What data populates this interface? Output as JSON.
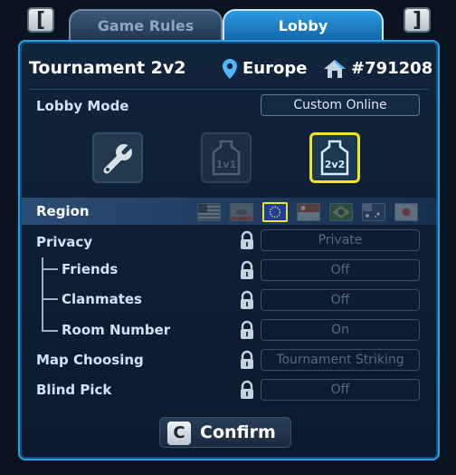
{
  "top_nav": {
    "prev_key": "[",
    "next_key": "]"
  },
  "tabs": [
    {
      "label": "Game Rules"
    },
    {
      "label": "Lobby"
    }
  ],
  "header": {
    "title": "Tournament 2v2",
    "region": "Europe",
    "lobby_id": "#791208"
  },
  "lobby_mode": {
    "label": "Lobby Mode",
    "value": "Custom Online",
    "modes": [
      {
        "icon": "wrench-icon"
      },
      {
        "icon": "1v1-mode-icon",
        "text": "1v1"
      },
      {
        "icon": "2v2-mode-icon",
        "text": "2v2",
        "selected": true
      }
    ]
  },
  "region_row": {
    "label": "Region",
    "flags": [
      "usa-flag-icon",
      "california-flag-icon",
      "eu-flag-icon",
      "singapore-flag-icon",
      "brazil-flag-icon",
      "australia-flag-icon",
      "japan-flag-icon"
    ],
    "selected_index": 2
  },
  "settings": {
    "privacy": {
      "label": "Privacy",
      "value": "Private"
    },
    "friends": {
      "label": "Friends",
      "value": "Off"
    },
    "clanmates": {
      "label": "Clanmates",
      "value": "Off"
    },
    "room_number": {
      "label": "Room Number",
      "value": "On"
    },
    "map_choosing": {
      "label": "Map Choosing",
      "value": "Tournament Striking"
    },
    "blind_pick": {
      "label": "Blind Pick",
      "value": "Off"
    }
  },
  "confirm": {
    "key": "C",
    "label": "Confirm"
  },
  "colors": {
    "accent": "#2e9de4",
    "selected_outline": "#f2e32a",
    "panel_bg": "#10243b"
  }
}
